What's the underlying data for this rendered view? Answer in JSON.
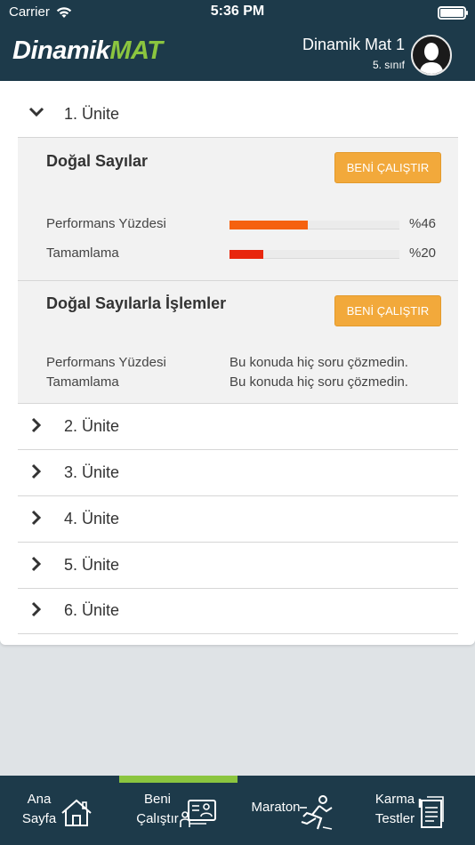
{
  "status_bar": {
    "carrier": "Carrier",
    "time": "5:36 PM"
  },
  "header": {
    "logo_white": "Dinamik",
    "logo_green": "MAT",
    "user_name": "Dinamik Mat 1",
    "user_grade": "5. sınıf"
  },
  "units": [
    {
      "label": "1. Ünite",
      "expanded": true
    },
    {
      "label": "2. Ünite",
      "expanded": false
    },
    {
      "label": "3. Ünite",
      "expanded": false
    },
    {
      "label": "4. Ünite",
      "expanded": false
    },
    {
      "label": "5. Ünite",
      "expanded": false
    },
    {
      "label": "6. Ünite",
      "expanded": false
    }
  ],
  "topics": [
    {
      "title": "Doğal Sayılar",
      "button": "BENİ ÇALIŞTIR",
      "performance_label": "Performans Yüzdesi",
      "performance_value": "%46",
      "performance_fraction": 0.46,
      "completion_label": "Tamamlama",
      "completion_value": "%20",
      "completion_fraction": 0.2
    },
    {
      "title": "Doğal Sayılarla İşlemler",
      "button": "BENİ ÇALIŞTIR",
      "performance_label": "Performans Yüzdesi",
      "performance_text": "Bu konuda hiç soru çözmedin.",
      "completion_label": "Tamamlama",
      "completion_text": "Bu konuda hiç soru çözmedin."
    }
  ],
  "tabbar": {
    "active": "beni_calistir",
    "items": [
      {
        "line1": "Ana",
        "line2": "Sayfa",
        "icon": "home-icon"
      },
      {
        "line1": "Beni",
        "line2": "Çalıştır",
        "icon": "study-screen-icon"
      },
      {
        "line1": "Maraton",
        "line2": "",
        "icon": "runner-icon"
      },
      {
        "line1": "Karma",
        "line2": "Testler",
        "icon": "test-papers-icon"
      }
    ]
  },
  "colors": {
    "header_bg": "#1d3a4a",
    "brand_green": "#8bc53f",
    "button_orange": "#f2a93b",
    "performance_bar": "#f5610f",
    "completion_bar": "#e8260e"
  }
}
